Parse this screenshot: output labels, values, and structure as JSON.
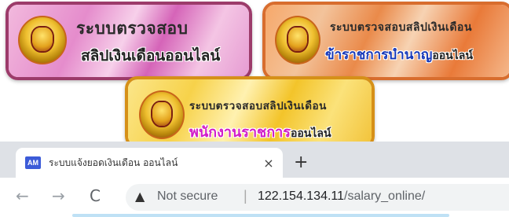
{
  "banners": [
    {
      "line1": "ระบบตรวจสอบ",
      "line2": "สลิปเงินเดือนออนไลน์",
      "line2_rest": ""
    },
    {
      "line1": "ระบบตรวจสอบสลิปเงินเดือน",
      "line2": "ข้าราชการบำนาญ",
      "line2_rest": "ออนไลน์"
    },
    {
      "line1": "ระบบตรวจสอบสลิปเงินเดือน",
      "line2": "พนักงานราชการ",
      "line2_rest": "ออนไลน์"
    }
  ],
  "colors": {
    "banner1_border": "#9c3b6a",
    "banner2_border": "#d86d2e",
    "banner3_border": "#d69018",
    "pension_text": "#1537b8",
    "staff_text": "#d11ec8"
  },
  "browser": {
    "tab": {
      "favicon_text": "AM",
      "title": "ระบบแจ้งยอดเงินเดือน ออนไลน์",
      "close_icon": "×"
    },
    "new_tab_icon": "+",
    "nav": {
      "back": "←",
      "forward": "→",
      "reload": "C"
    },
    "address": {
      "warning_icon": "▲",
      "security_label": "Not secure",
      "separator": "|",
      "host": "122.154.134.11",
      "path": "/salary_online/"
    }
  }
}
